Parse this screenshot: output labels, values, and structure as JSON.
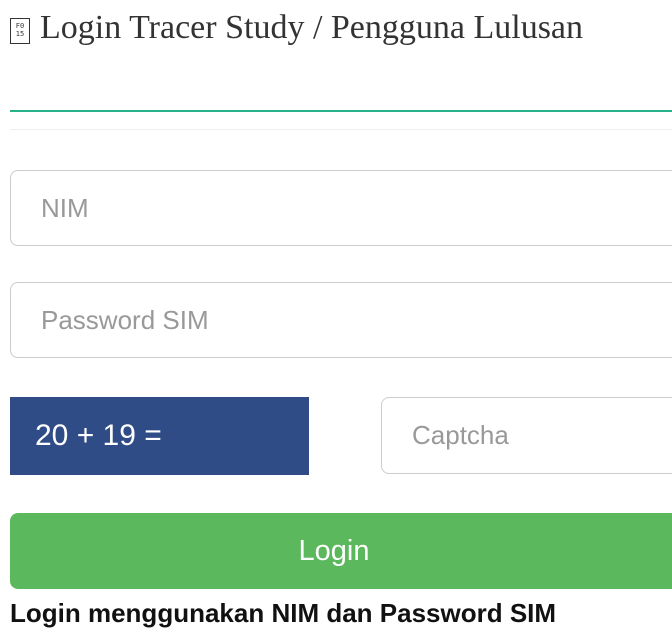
{
  "header": {
    "icon_name": "form-icon",
    "icon_glyph": "F0 15",
    "title": "Login Tracer Study / Pengguna Lulusan"
  },
  "form": {
    "nim_placeholder": "NIM",
    "password_placeholder": "Password SIM",
    "captcha_question": "20 + 19 =",
    "captcha_placeholder": "Captcha",
    "login_label": "Login",
    "hint": "Login menggunakan NIM dan Password SIM"
  },
  "colors": {
    "accent_rule": "#29b28a",
    "captcha_bg": "#2f4c86",
    "login_button": "#5cb85c"
  }
}
